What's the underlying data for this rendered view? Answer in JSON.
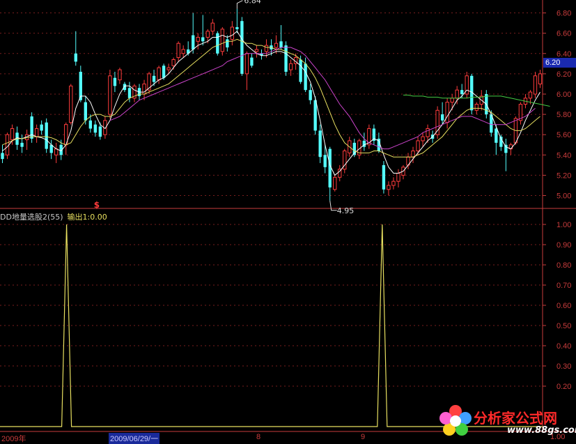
{
  "chart_data": [
    {
      "type": "candlestick",
      "price_axis": {
        "ticks": [
          "6.80",
          "6.60",
          "6.40",
          "6.20",
          "6.00",
          "5.80",
          "5.60",
          "5.40",
          "5.20",
          "5.00"
        ],
        "ylim": [
          4.88,
          6.9
        ]
      },
      "high_marker": "6.84",
      "low_marker": "4.95",
      "current_price": "6.20",
      "candles": [
        {
          "o": 5.42,
          "h": 5.5,
          "l": 5.32,
          "c": 5.36
        },
        {
          "o": 5.4,
          "h": 5.62,
          "l": 5.36,
          "c": 5.6
        },
        {
          "o": 5.55,
          "h": 5.7,
          "l": 5.5,
          "c": 5.66
        },
        {
          "o": 5.62,
          "h": 5.68,
          "l": 5.45,
          "c": 5.5
        },
        {
          "o": 5.52,
          "h": 5.6,
          "l": 5.42,
          "c": 5.48
        },
        {
          "o": 5.55,
          "h": 5.65,
          "l": 5.45,
          "c": 5.6
        },
        {
          "o": 5.78,
          "h": 5.82,
          "l": 5.52,
          "c": 5.56
        },
        {
          "o": 5.58,
          "h": 5.7,
          "l": 5.52,
          "c": 5.66
        },
        {
          "o": 5.7,
          "h": 5.74,
          "l": 5.6,
          "c": 5.64
        },
        {
          "o": 5.72,
          "h": 5.76,
          "l": 5.42,
          "c": 5.46
        },
        {
          "o": 5.5,
          "h": 5.55,
          "l": 5.36,
          "c": 5.42
        },
        {
          "o": 5.4,
          "h": 5.52,
          "l": 5.32,
          "c": 5.46
        },
        {
          "o": 5.5,
          "h": 5.55,
          "l": 5.35,
          "c": 5.4
        },
        {
          "o": 5.5,
          "h": 5.72,
          "l": 5.4,
          "c": 5.7
        },
        {
          "o": 5.72,
          "h": 6.1,
          "l": 5.7,
          "c": 6.08
        },
        {
          "o": 6.4,
          "h": 6.62,
          "l": 6.28,
          "c": 6.32
        },
        {
          "o": 6.22,
          "h": 6.28,
          "l": 5.92,
          "c": 5.94
        },
        {
          "o": 5.92,
          "h": 5.98,
          "l": 5.7,
          "c": 5.74
        },
        {
          "o": 5.74,
          "h": 5.8,
          "l": 5.62,
          "c": 5.66
        },
        {
          "o": 5.7,
          "h": 5.74,
          "l": 5.58,
          "c": 5.62
        },
        {
          "o": 5.68,
          "h": 5.72,
          "l": 5.55,
          "c": 5.58
        },
        {
          "o": 5.6,
          "h": 5.78,
          "l": 5.56,
          "c": 5.74
        },
        {
          "o": 5.8,
          "h": 6.24,
          "l": 5.76,
          "c": 6.18
        },
        {
          "o": 6.16,
          "h": 6.22,
          "l": 6.02,
          "c": 6.08
        },
        {
          "o": 6.14,
          "h": 6.26,
          "l": 6.1,
          "c": 6.24
        },
        {
          "o": 6.1,
          "h": 6.12,
          "l": 6.02,
          "c": 6.04
        },
        {
          "o": 6.06,
          "h": 6.12,
          "l": 5.92,
          "c": 5.96
        },
        {
          "o": 5.96,
          "h": 6.1,
          "l": 5.92,
          "c": 6.08
        },
        {
          "o": 6.06,
          "h": 6.1,
          "l": 5.94,
          "c": 5.98
        },
        {
          "o": 6.0,
          "h": 6.14,
          "l": 5.94,
          "c": 6.1
        },
        {
          "o": 6.04,
          "h": 6.22,
          "l": 6.0,
          "c": 6.2
        },
        {
          "o": 6.18,
          "h": 6.24,
          "l": 6.08,
          "c": 6.12
        },
        {
          "o": 6.14,
          "h": 6.28,
          "l": 6.1,
          "c": 6.26
        },
        {
          "o": 6.28,
          "h": 6.3,
          "l": 6.14,
          "c": 6.16
        },
        {
          "o": 6.24,
          "h": 6.3,
          "l": 6.2,
          "c": 6.26
        },
        {
          "o": 6.28,
          "h": 6.36,
          "l": 6.24,
          "c": 6.34
        },
        {
          "o": 6.36,
          "h": 6.52,
          "l": 6.32,
          "c": 6.5
        },
        {
          "o": 6.4,
          "h": 6.48,
          "l": 6.36,
          "c": 6.44
        },
        {
          "o": 6.44,
          "h": 6.52,
          "l": 6.38,
          "c": 6.4
        },
        {
          "o": 6.58,
          "h": 6.8,
          "l": 6.4,
          "c": 6.44
        },
        {
          "o": 6.52,
          "h": 6.6,
          "l": 6.44,
          "c": 6.56
        },
        {
          "o": 6.56,
          "h": 6.78,
          "l": 6.48,
          "c": 6.52
        },
        {
          "o": 6.56,
          "h": 6.64,
          "l": 6.5,
          "c": 6.62
        },
        {
          "o": 6.62,
          "h": 6.74,
          "l": 6.58,
          "c": 6.7
        },
        {
          "o": 6.6,
          "h": 6.62,
          "l": 6.38,
          "c": 6.4
        },
        {
          "o": 6.42,
          "h": 6.66,
          "l": 6.38,
          "c": 6.64
        },
        {
          "o": 6.54,
          "h": 6.58,
          "l": 6.42,
          "c": 6.46
        },
        {
          "o": 6.54,
          "h": 6.72,
          "l": 6.48,
          "c": 6.66
        },
        {
          "o": 6.66,
          "h": 6.84,
          "l": 6.6,
          "c": 6.64
        },
        {
          "o": 6.72,
          "h": 6.76,
          "l": 6.18,
          "c": 6.2
        },
        {
          "o": 6.2,
          "h": 6.42,
          "l": 6.04,
          "c": 6.4
        },
        {
          "o": 6.36,
          "h": 6.4,
          "l": 6.26,
          "c": 6.28
        },
        {
          "o": 6.42,
          "h": 6.48,
          "l": 6.36,
          "c": 6.44
        },
        {
          "o": 6.4,
          "h": 6.44,
          "l": 6.34,
          "c": 6.38
        },
        {
          "o": 6.42,
          "h": 6.54,
          "l": 6.36,
          "c": 6.48
        },
        {
          "o": 6.48,
          "h": 6.54,
          "l": 6.38,
          "c": 6.44
        },
        {
          "o": 6.46,
          "h": 6.58,
          "l": 6.4,
          "c": 6.5
        },
        {
          "o": 6.52,
          "h": 6.68,
          "l": 6.44,
          "c": 6.46
        },
        {
          "o": 6.48,
          "h": 6.52,
          "l": 6.18,
          "c": 6.22
        },
        {
          "o": 6.24,
          "h": 6.34,
          "l": 6.18,
          "c": 6.3
        },
        {
          "o": 6.3,
          "h": 6.4,
          "l": 6.24,
          "c": 6.36
        },
        {
          "o": 6.34,
          "h": 6.38,
          "l": 6.1,
          "c": 6.12
        },
        {
          "o": 6.3,
          "h": 6.36,
          "l": 6.02,
          "c": 6.04
        },
        {
          "o": 6.04,
          "h": 6.1,
          "l": 5.9,
          "c": 5.94
        },
        {
          "o": 5.94,
          "h": 5.98,
          "l": 5.6,
          "c": 5.64
        },
        {
          "o": 5.64,
          "h": 5.7,
          "l": 5.32,
          "c": 5.38
        },
        {
          "o": 5.4,
          "h": 5.5,
          "l": 5.22,
          "c": 5.28
        },
        {
          "o": 5.46,
          "h": 5.48,
          "l": 4.95,
          "c": 5.08
        },
        {
          "o": 5.06,
          "h": 5.2,
          "l": 5.04,
          "c": 5.18
        },
        {
          "o": 5.18,
          "h": 5.3,
          "l": 5.14,
          "c": 5.26
        },
        {
          "o": 5.26,
          "h": 5.46,
          "l": 5.22,
          "c": 5.44
        },
        {
          "o": 5.42,
          "h": 5.58,
          "l": 5.38,
          "c": 5.54
        },
        {
          "o": 5.52,
          "h": 5.56,
          "l": 5.38,
          "c": 5.4
        },
        {
          "o": 5.4,
          "h": 5.56,
          "l": 5.36,
          "c": 5.54
        },
        {
          "o": 5.54,
          "h": 5.62,
          "l": 5.44,
          "c": 5.48
        },
        {
          "o": 5.5,
          "h": 5.7,
          "l": 5.46,
          "c": 5.66
        },
        {
          "o": 5.66,
          "h": 5.7,
          "l": 5.5,
          "c": 5.54
        },
        {
          "o": 5.56,
          "h": 5.62,
          "l": 5.42,
          "c": 5.44
        },
        {
          "o": 5.3,
          "h": 5.34,
          "l": 5.02,
          "c": 5.06
        },
        {
          "o": 5.06,
          "h": 5.14,
          "l": 5.0,
          "c": 5.1
        },
        {
          "o": 5.1,
          "h": 5.18,
          "l": 5.06,
          "c": 5.14
        },
        {
          "o": 5.14,
          "h": 5.26,
          "l": 5.08,
          "c": 5.22
        },
        {
          "o": 5.2,
          "h": 5.3,
          "l": 5.16,
          "c": 5.28
        },
        {
          "o": 5.3,
          "h": 5.42,
          "l": 5.26,
          "c": 5.38
        },
        {
          "o": 5.38,
          "h": 5.48,
          "l": 5.32,
          "c": 5.44
        },
        {
          "o": 5.44,
          "h": 5.58,
          "l": 5.4,
          "c": 5.54
        },
        {
          "o": 5.54,
          "h": 5.62,
          "l": 5.48,
          "c": 5.58
        },
        {
          "o": 5.58,
          "h": 5.7,
          "l": 5.52,
          "c": 5.66
        },
        {
          "o": 5.6,
          "h": 5.64,
          "l": 5.52,
          "c": 5.56
        },
        {
          "o": 5.6,
          "h": 5.88,
          "l": 5.56,
          "c": 5.84
        },
        {
          "o": 5.8,
          "h": 5.92,
          "l": 5.7,
          "c": 5.74
        },
        {
          "o": 5.72,
          "h": 5.96,
          "l": 5.66,
          "c": 5.92
        },
        {
          "o": 5.92,
          "h": 6.0,
          "l": 5.84,
          "c": 5.96
        },
        {
          "o": 5.96,
          "h": 6.08,
          "l": 5.9,
          "c": 6.04
        },
        {
          "o": 6.04,
          "h": 6.1,
          "l": 5.96,
          "c": 6.0
        },
        {
          "o": 6.0,
          "h": 6.22,
          "l": 5.96,
          "c": 6.18
        },
        {
          "o": 6.18,
          "h": 6.2,
          "l": 5.8,
          "c": 5.84
        },
        {
          "o": 5.84,
          "h": 5.92,
          "l": 5.8,
          "c": 5.9
        },
        {
          "o": 5.9,
          "h": 6.04,
          "l": 5.84,
          "c": 5.98
        },
        {
          "o": 6.0,
          "h": 6.04,
          "l": 5.76,
          "c": 5.8
        },
        {
          "o": 5.8,
          "h": 5.84,
          "l": 5.58,
          "c": 5.62
        },
        {
          "o": 5.66,
          "h": 5.7,
          "l": 5.4,
          "c": 5.52
        },
        {
          "o": 5.58,
          "h": 5.6,
          "l": 5.44,
          "c": 5.48
        },
        {
          "o": 5.5,
          "h": 5.56,
          "l": 5.24,
          "c": 5.42
        },
        {
          "o": 5.46,
          "h": 5.52,
          "l": 5.4,
          "c": 5.5
        },
        {
          "o": 5.52,
          "h": 5.78,
          "l": 5.5,
          "c": 5.76
        },
        {
          "o": 5.74,
          "h": 5.92,
          "l": 5.7,
          "c": 5.9
        },
        {
          "o": 5.9,
          "h": 6.0,
          "l": 5.86,
          "c": 5.96
        },
        {
          "o": 5.96,
          "h": 6.04,
          "l": 5.9,
          "c": 6.02
        },
        {
          "o": 6.0,
          "h": 6.22,
          "l": 5.96,
          "c": 6.18
        },
        {
          "o": 6.1,
          "h": 6.24,
          "l": 6.06,
          "c": 6.2
        }
      ],
      "ma_lines": [
        {
          "color": "#ffffff",
          "values": [
            5.44,
            5.48,
            5.54,
            5.57,
            5.56,
            5.58,
            5.6,
            5.58,
            5.57,
            5.55,
            5.5,
            5.46,
            5.44,
            5.5,
            5.64,
            5.86,
            5.98,
            5.98,
            5.92,
            5.8,
            5.7,
            5.66,
            5.74,
            5.88,
            6.0,
            6.08,
            6.08,
            6.04,
            6.02,
            6.02,
            6.06,
            6.1,
            6.14,
            6.16,
            6.2,
            6.26,
            6.32,
            6.36,
            6.4,
            6.44,
            6.48,
            6.5,
            6.52,
            6.56,
            6.56,
            6.58,
            6.56,
            6.58,
            6.62,
            6.54,
            6.48,
            6.44,
            6.4,
            6.38,
            6.38,
            6.4,
            6.42,
            6.42,
            6.4,
            6.36,
            6.32,
            6.28,
            6.22,
            6.12,
            5.96,
            5.74,
            5.5,
            5.3,
            5.2,
            5.24,
            5.3,
            5.36,
            5.42,
            5.46,
            5.5,
            5.52,
            5.56,
            5.54,
            5.4,
            5.28,
            5.22,
            5.22,
            5.24,
            5.3,
            5.36,
            5.42,
            5.48,
            5.54,
            5.58,
            5.64,
            5.7,
            5.78,
            5.86,
            5.94,
            5.98,
            6.04,
            6.02,
            5.98,
            5.94,
            5.9,
            5.8,
            5.68,
            5.56,
            5.48,
            5.46,
            5.52,
            5.62,
            5.74,
            5.84,
            5.94,
            6.02
          ]
        },
        {
          "color": "#e8e060",
          "values": [
            5.5,
            5.52,
            5.54,
            5.56,
            5.56,
            5.57,
            5.58,
            5.58,
            5.58,
            5.58,
            5.57,
            5.55,
            5.52,
            5.5,
            5.52,
            5.6,
            5.68,
            5.74,
            5.78,
            5.8,
            5.8,
            5.78,
            5.78,
            5.8,
            5.86,
            5.92,
            5.96,
            5.98,
            6.0,
            6.0,
            6.02,
            6.04,
            6.06,
            6.08,
            6.1,
            6.14,
            6.18,
            6.22,
            6.26,
            6.3,
            6.34,
            6.38,
            6.42,
            6.46,
            6.48,
            6.5,
            6.52,
            6.52,
            6.54,
            6.52,
            6.5,
            6.5,
            6.48,
            6.48,
            6.46,
            6.46,
            6.44,
            6.44,
            6.42,
            6.4,
            6.38,
            6.34,
            6.3,
            6.24,
            6.16,
            6.06,
            5.94,
            5.82,
            5.7,
            5.6,
            5.52,
            5.48,
            5.44,
            5.42,
            5.42,
            5.42,
            5.44,
            5.44,
            5.42,
            5.4,
            5.38,
            5.38,
            5.38,
            5.38,
            5.38,
            5.4,
            5.42,
            5.46,
            5.5,
            5.54,
            5.58,
            5.64,
            5.7,
            5.76,
            5.8,
            5.84,
            5.86,
            5.86,
            5.86,
            5.84,
            5.82,
            5.78,
            5.74,
            5.7,
            5.66,
            5.64,
            5.64,
            5.66,
            5.7,
            5.74,
            5.78
          ]
        },
        {
          "color": "#cc44cc",
          "from": 22,
          "values": [
            5.74,
            5.76,
            5.78,
            5.82,
            5.86,
            5.9,
            5.94,
            5.96,
            5.98,
            6.0,
            6.02,
            6.04,
            6.06,
            6.08,
            6.1,
            6.12,
            6.14,
            6.16,
            6.18,
            6.2,
            6.22,
            6.24,
            6.26,
            6.28,
            6.32,
            6.34,
            6.36,
            6.38,
            6.4,
            6.4,
            6.4,
            6.4,
            6.4,
            6.42,
            6.44,
            6.46,
            6.46,
            6.46,
            6.44,
            6.42,
            6.38,
            6.32,
            6.26,
            6.2,
            6.14,
            6.06,
            5.98,
            5.9,
            5.84,
            5.78,
            5.7,
            5.62,
            5.56,
            5.52,
            5.5,
            5.48,
            5.46,
            5.46,
            5.48,
            5.5,
            5.52,
            5.54,
            5.56,
            5.58,
            5.62,
            5.64,
            5.66,
            5.68,
            5.7,
            5.72,
            5.74,
            5.76,
            5.78,
            5.78,
            5.78,
            5.76,
            5.74,
            5.72,
            5.7,
            5.7,
            5.7,
            5.7,
            5.72,
            5.74,
            5.76,
            5.78,
            5.82,
            5.86
          ]
        },
        {
          "color": "#44cc44",
          "from": 82,
          "values": [
            5.99,
            5.99,
            5.98,
            5.98,
            5.98,
            5.97,
            5.97,
            5.97,
            5.96,
            5.96,
            5.96,
            5.96,
            5.96,
            5.96,
            5.97,
            5.97,
            5.97,
            5.98,
            5.98,
            5.98,
            5.98,
            5.97,
            5.96,
            5.95,
            5.94,
            5.93,
            5.92,
            5.91,
            5.9,
            5.89,
            5.88
          ]
        }
      ]
    },
    {
      "type": "line",
      "title": "DD地量选股2(55)",
      "output_label": "输出1:0.00",
      "y_ticks": [
        "1.00",
        "0.90",
        "0.80",
        "0.70",
        "0.60",
        "0.50",
        "0.40",
        "0.30",
        "0.20"
      ],
      "ylim": [
        0,
        1.0
      ],
      "series": [
        {
          "color": "#e8e060",
          "spikes_at": [
            13,
            77
          ]
        }
      ],
      "length": 110
    }
  ],
  "dates": {
    "d1": "2009年",
    "d2": "2009/06/29/一",
    "d3": "8",
    "d4": "9",
    "d5": "1.00"
  },
  "marker_glyph": "$",
  "logo": {
    "text": "分析家公式网",
    "url": "www.88gs.com"
  }
}
